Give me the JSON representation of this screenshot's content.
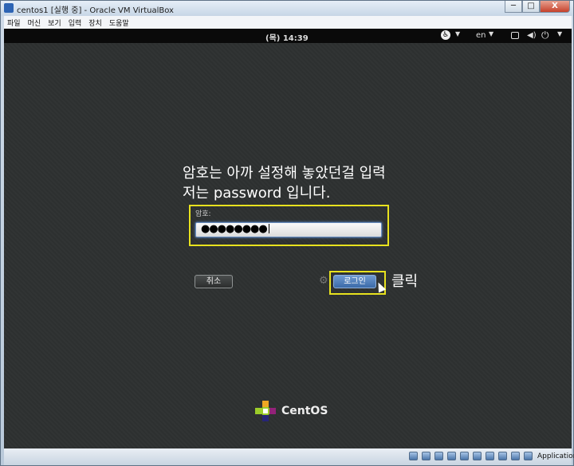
{
  "window": {
    "title": "centos1 [실행 중] - Oracle VM VirtualBox",
    "buttons": {
      "minimize": "─",
      "maximize": "□",
      "close": "X"
    }
  },
  "menubar": {
    "items": [
      "파일",
      "머신",
      "보기",
      "입력",
      "장치",
      "도움말"
    ]
  },
  "guest_topbar": {
    "clock": "(목) 14:39",
    "lang": "en"
  },
  "annotations": {
    "line1": "암호는 아까 설정해 놓았던걸 입력",
    "line2": "저는 password 입니다.",
    "click": "클릭"
  },
  "login": {
    "password_label": "암호:",
    "password_value": "●●●●●●●●",
    "cancel": "취소",
    "login": "로그인"
  },
  "brand": {
    "name": "CentOS"
  },
  "statusbar": {
    "host_key": "Application"
  },
  "colors": {
    "highlight": "#e8e21e",
    "screen_bg": "#2e3131",
    "login_button": "#4f7fbf"
  }
}
